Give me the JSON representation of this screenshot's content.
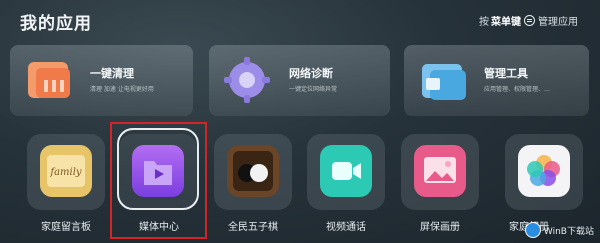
{
  "title": "我的应用",
  "hint": {
    "prefix": "按",
    "key": "菜单键",
    "suffix": "管理应用"
  },
  "cards": [
    {
      "label": "一键清理",
      "sub": "清理 加速 让电视更好用",
      "icon": "broom-icon",
      "color": "#f07a4a"
    },
    {
      "label": "网络诊断",
      "sub": "一键定位网络异常",
      "icon": "network-gear-icon",
      "color": "#8a7ae0"
    },
    {
      "label": "管理工具",
      "sub": "应用管理、权限管理、…",
      "icon": "toolbox-icon",
      "color": "#4aa8e0"
    }
  ],
  "apps": [
    {
      "label": "家庭留言板",
      "icon": "family-note-icon",
      "text": "family",
      "color": "#e8c468"
    },
    {
      "label": "媒体中心",
      "icon": "media-folder-icon",
      "color": "#8a4ee8"
    },
    {
      "label": "全民五子棋",
      "icon": "gomoku-icon",
      "color": "#6b4528"
    },
    {
      "label": "视频通话",
      "icon": "video-call-icon",
      "color": "#2cc9b4"
    },
    {
      "label": "屏保画册",
      "icon": "photo-album-icon",
      "color": "#e85a8a"
    },
    {
      "label": "家庭相册",
      "icon": "gallery-icon",
      "color": "#c07ae0"
    }
  ],
  "watermark": "WinB下载站"
}
